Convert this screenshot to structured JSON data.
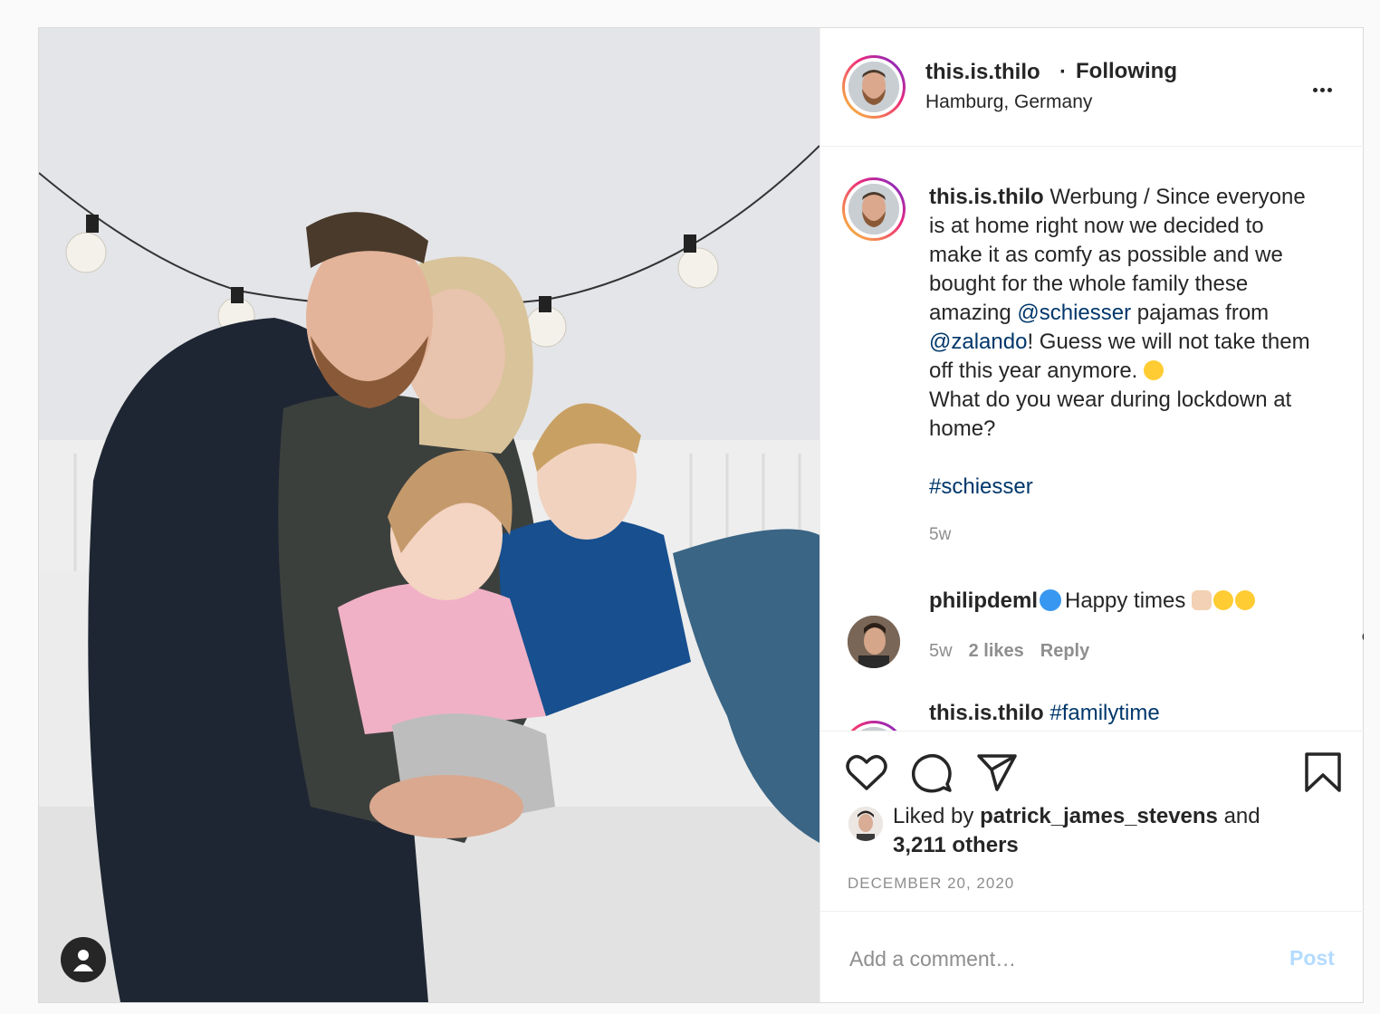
{
  "post": {
    "username": "this.is.thilo",
    "follow_status": "Following",
    "location": "Hamburg, Germany"
  },
  "caption": {
    "username": "this.is.thilo",
    "text_1": " Werbung / Since everyone\nis at home right now we decided to\nmake it as comfy as possible and we\nbought for the whole family these\namazing ",
    "mention_1": "@schiesser",
    "text_2": " pajamas from\n",
    "mention_2": "@zalando",
    "text_3": "! Guess we will not take them\noff this year anymore. ",
    "emoji": "joy-emoji",
    "text_4": "\nWhat do you wear during lockdown at\nhome?\n\n",
    "hashtag": "#schiesser",
    "time": "5w"
  },
  "comments": [
    {
      "username": "philipdeml",
      "text": "Happy times ",
      "emoji": [
        "folded-hands-emoji",
        "heart-eyes-emoji",
        "heart-eyes-emoji"
      ],
      "time": "5w",
      "likes": "2 likes",
      "reply_label": "Reply"
    },
    {
      "username": "this.is.thilo",
      "text": "#familytime"
    }
  ],
  "likes": {
    "prefix": "Liked by ",
    "user": "patrick_james_stevens",
    "middle": " and",
    "others": "3,211 others"
  },
  "date": "DECEMBER 20, 2020",
  "comment_box": {
    "placeholder": "Add a comment…",
    "post_label": "Post"
  },
  "colors": {
    "link": "#00376b",
    "muted": "#8e8e8e",
    "post_button_disabled": "#b3dbff",
    "verified": "#3897f0"
  }
}
